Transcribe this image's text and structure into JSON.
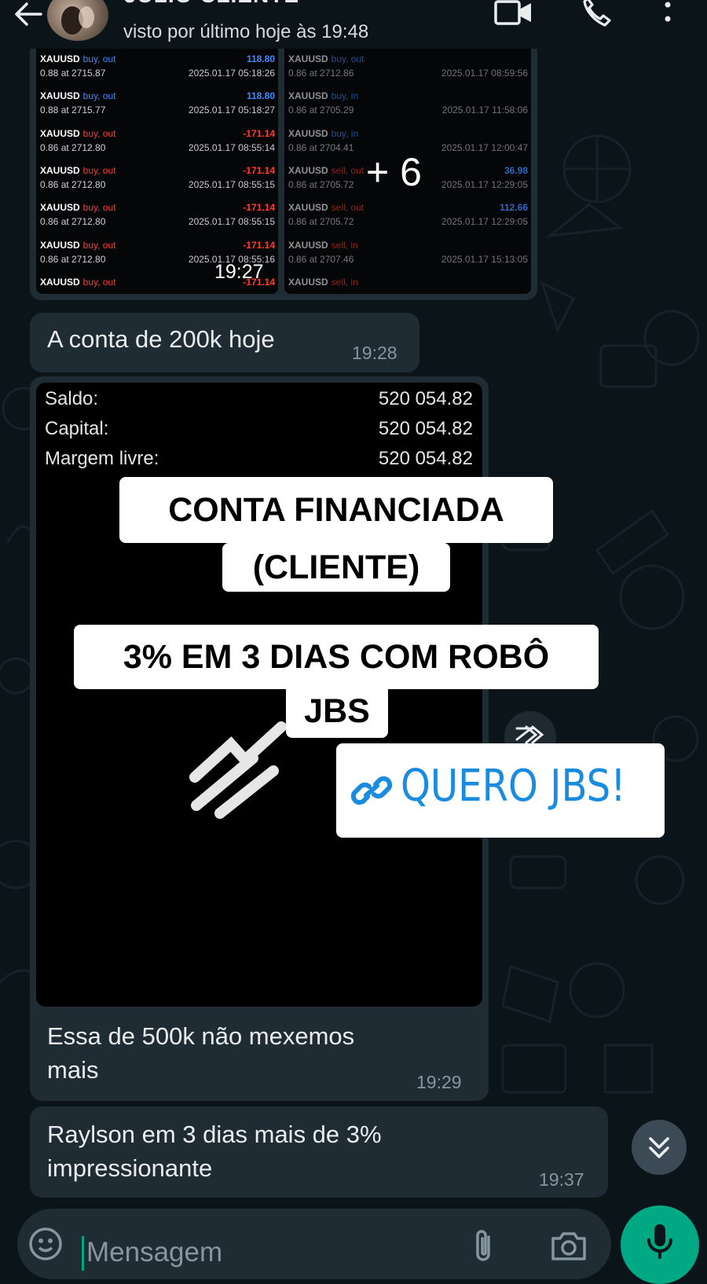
{
  "header": {
    "contact_name": "JÚLIO CLIENTE",
    "last_seen": "visto por último hoje às 19:48"
  },
  "media_group": {
    "more_count": "+ 6",
    "time": "19:27",
    "left_trades": [
      {
        "symbol": "XAUUSD",
        "side": "buy, out",
        "lot": "0.88 at 2715.87",
        "date": "2025.01.17 05:18:26",
        "profit": "118.80",
        "color": "blue"
      },
      {
        "symbol": "XAUUSD",
        "side": "buy, out",
        "lot": "0.88 at 2715.77",
        "date": "2025.01.17 05:18:27",
        "profit": "118.80",
        "color": "blue"
      },
      {
        "symbol": "XAUUSD",
        "side": "buy, out",
        "lot": "0.86 at 2712.80",
        "date": "2025.01.17 08:55:14",
        "profit": "-171.14",
        "color": "red"
      },
      {
        "symbol": "XAUUSD",
        "side": "buy, out",
        "lot": "0.86 at 2712.80",
        "date": "2025.01.17 08:55:15",
        "profit": "-171.14",
        "color": "red"
      },
      {
        "symbol": "XAUUSD",
        "side": "buy, out",
        "lot": "0.86 at 2712.80",
        "date": "2025.01.17 08:55:15",
        "profit": "-171.14",
        "color": "red"
      },
      {
        "symbol": "XAUUSD",
        "side": "buy, out",
        "lot": "0.86 at 2712.80",
        "date": "2025.01.17 08:55:16",
        "profit": "-171.14",
        "color": "red"
      },
      {
        "symbol": "XAUUSD",
        "side": "buy, out",
        "lot": "",
        "date": "",
        "profit": "-171.14",
        "color": "red"
      }
    ],
    "right_trades": [
      {
        "symbol": "XAUUSD",
        "side": "buy, out",
        "lot": "0.86 at 2712.86",
        "date": "2025.01.17 08:59:56",
        "profit": "",
        "color": "blue"
      },
      {
        "symbol": "XAUUSD",
        "side": "buy, in",
        "lot": "0.86 at 2705.29",
        "date": "2025.01.17 11:58:06",
        "profit": "",
        "color": "blue"
      },
      {
        "symbol": "XAUUSD",
        "side": "buy, in",
        "lot": "0.86 at 2704.41",
        "date": "2025.01.17 12:00:47",
        "profit": "",
        "color": "blue"
      },
      {
        "symbol": "XAUUSD",
        "side": "sell, out",
        "lot": "0.86 at 2705.72",
        "date": "2025.01.17 12:29:05",
        "profit": "36.98",
        "color": "red"
      },
      {
        "symbol": "XAUUSD",
        "side": "sell, out",
        "lot": "0.86 at 2705.72",
        "date": "2025.01.17 12:29:05",
        "profit": "112.66",
        "color": "red"
      },
      {
        "symbol": "XAUUSD",
        "side": "sell, in",
        "lot": "0.86 at 2707.46",
        "date": "2025.01.17 15:13:05",
        "profit": "",
        "color": "red"
      },
      {
        "symbol": "XAUUSD",
        "side": "sell, in",
        "lot": "",
        "date": "",
        "profit": "",
        "color": "red"
      }
    ]
  },
  "msg1": {
    "text": "A conta de 200k hoje",
    "time": "19:28"
  },
  "account": {
    "rows": [
      {
        "label": "Saldo:",
        "value": "520 054.82"
      },
      {
        "label": "Capital:",
        "value": "520 054.82"
      },
      {
        "label": "Margem livre:",
        "value": "520 054.82"
      }
    ],
    "banner1_line1": "CONTA FINANCIADA",
    "banner1_line2": "(CLIENTE)",
    "banner2_line1": "3% EM 3 DIAS COM ROBÔ",
    "banner2_line2": "JBS",
    "cta": "QUERO JBS!"
  },
  "msg2": {
    "line1": "Essa de 500k não mexemos",
    "line2": "mais",
    "time": "19:29"
  },
  "msg3": {
    "line1": "Raylson em 3 dias mais de 3%",
    "line2": "impressionante",
    "time": "19:37"
  },
  "composer": {
    "placeholder": "Mensagem"
  },
  "colors": {
    "profit_blue": "#3d8bff",
    "loss_red": "#ff3b30",
    "accent": "#00a884",
    "link": "#1a8ce0"
  },
  "icons": [
    "back-arrow-icon",
    "video-call-icon",
    "phone-icon",
    "more-vert-icon",
    "forward-icon",
    "link-icon",
    "scroll-down-icon",
    "sticker-icon",
    "attach-icon",
    "camera-icon",
    "mic-icon"
  ]
}
